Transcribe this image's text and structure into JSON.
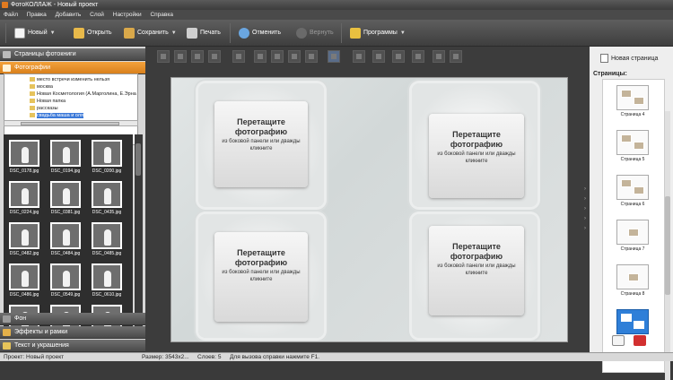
{
  "window": {
    "title": "ФотоКОЛЛАЖ - Новый проект"
  },
  "menu": [
    "Файл",
    "Правка",
    "Добавить",
    "Слой",
    "Настройки",
    "Справка"
  ],
  "toolbar": {
    "new_label": "Новый",
    "open_label": "Открыть",
    "save_label": "Сохранить",
    "print_label": "Печать",
    "undo_label": "Отменить",
    "redo_label": "Вернуть",
    "programs_label": "Программы"
  },
  "left_panel": {
    "album_pages_header": "Страницы фотокниги",
    "photos_header": "Фотографии",
    "tree": [
      "место встречи изменить нельзя",
      "москва",
      "Новая Косметология (А.Марголина, Е.Эрна",
      "Новая папка",
      "рассказы",
      "свадьба маша и оля"
    ],
    "thumbnails": [
      "DSC_0178.jpg",
      "DSC_0194.jpg",
      "DSC_0200.jpg",
      "DSC_0224.jpg",
      "DSC_0381.jpg",
      "DSC_0435.jpg",
      "DSC_0482.jpg",
      "DSC_0484.jpg",
      "DSC_0485.jpg",
      "DSC_0486.jpg",
      "DSC_0549.jpg",
      "DSC_0610.jpg"
    ],
    "background_header": "Фон",
    "effects_header": "Эффекты и рамки",
    "text_header": "Текст и украшения"
  },
  "canvas": {
    "slots": [
      {
        "title": "Перетащите фотографию",
        "hint": "из боковой панели или дважды кликните"
      },
      {
        "title": "Перетащите фотографию",
        "hint": "из боковой панели или дважды кликните"
      },
      {
        "title": "Перетащите фотографию",
        "hint": "из боковой панели или дважды кликните"
      },
      {
        "title": "Перетащите фотографию",
        "hint": "из боковой панели или дважды кликните"
      }
    ]
  },
  "right_panel": {
    "new_page_label": "Новая страница",
    "pages_label": "Страницы:",
    "pages": [
      "Страница 4",
      "Страница 5",
      "Страница 6",
      "Страница 7",
      "Страница 8"
    ]
  },
  "status": {
    "project": "Проект: Новый проект",
    "size": "Размер: 3543x2...",
    "layers": "Слоев: 5",
    "help": "Для вызова справки нажмите F1."
  },
  "colors": {
    "accent": "#e8901f",
    "selected_page": "#2f7fd8",
    "dark_bg": "#3c3c3c"
  }
}
